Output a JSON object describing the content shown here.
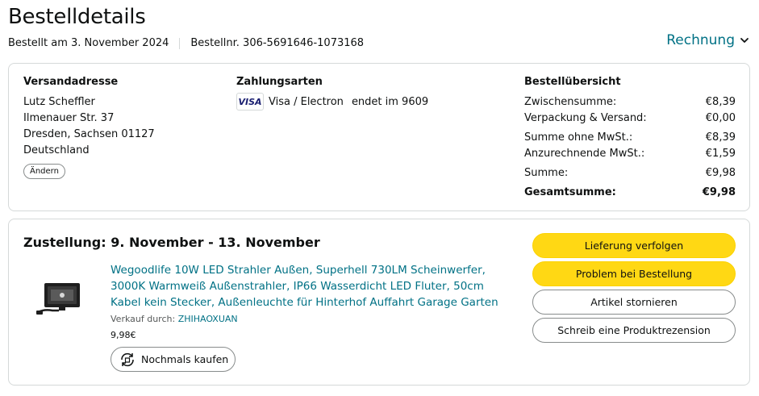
{
  "page": {
    "title": "Bestelldetails",
    "ordered_on": "Bestellt am 3. November 2024",
    "order_number": "Bestellnr. 306-5691646-1073168",
    "invoice_label": "Rechnung"
  },
  "shipping": {
    "heading": "Versandadresse",
    "lines": [
      "Lutz Scheffler",
      "Ilmenauer Str. 37",
      "Dresden, Sachsen 01127",
      "Deutschland"
    ],
    "change_label": "Ändern"
  },
  "payment": {
    "heading": "Zahlungsarten",
    "card_logo": "VISA",
    "card_type": "Visa / Electron",
    "card_ending": "endet im 9609"
  },
  "summary": {
    "heading": "Bestellübersicht",
    "rows": [
      {
        "label": "Zwischensumme:",
        "value": "€8,39"
      },
      {
        "label": "Verpackung & Versand:",
        "value": "€0,00"
      },
      {
        "label": "Summe ohne MwSt.:",
        "value": "€8,39"
      },
      {
        "label": "Anzurechnende MwSt.:",
        "value": "€1,59"
      },
      {
        "label": "Summe:",
        "value": "€9,98"
      }
    ],
    "total": {
      "label": "Gesamtsumme:",
      "value": "€9,98"
    }
  },
  "shipment": {
    "delivery_title": "Zustellung: 9. November - 13. November",
    "product_title": "Wegoodlife 10W LED Strahler Außen, Superhell 730LM Scheinwerfer, 3000K Warmweiß Außenstrahler, IP66 Wasserdicht LED Fluter, 50cm Kabel kein Stecker, Außenleuchte für Hinterhof Auffahrt Garage Garten",
    "seller_prefix": "Verkauf durch:",
    "seller_name": "ZHIHAOXUAN",
    "price": "9,98€",
    "buy_again_label": "Nochmals kaufen",
    "actions": {
      "track": "Lieferung verfolgen",
      "problem": "Problem bei Bestellung",
      "cancel": "Artikel stornieren",
      "review": "Schreib eine Produktrezension"
    }
  },
  "colors": {
    "link": "#007185",
    "primary_button": "#ffd814",
    "border": "#d5d9d9"
  }
}
